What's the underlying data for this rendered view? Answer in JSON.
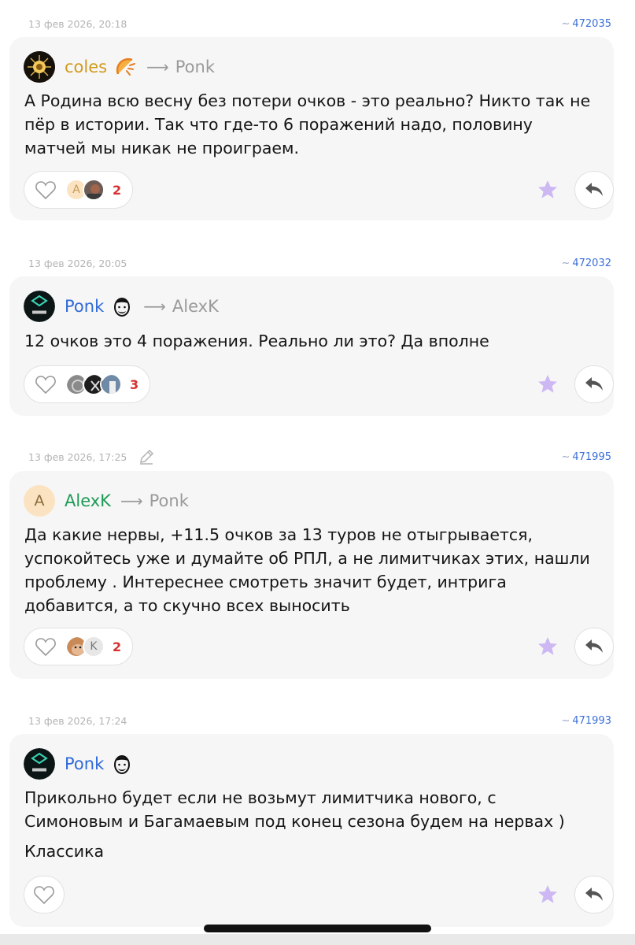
{
  "comments": [
    {
      "date": "13 фев 2026, 20:18",
      "ref_prefix": "~",
      "ref": "472035",
      "author": "coles",
      "arrow": "⟶",
      "reply_to": "Ponk",
      "paragraphs": [
        "А Родина всю весну без потери очков - это реально? Никто так не пёр в истории. Так что где-то 6 поражений надо, половину матчей мы никак не проиграем."
      ],
      "likers": [
        "А"
      ],
      "like_count": "2"
    },
    {
      "date": "13 фев 2026, 20:05",
      "ref_prefix": "~",
      "ref": "472032",
      "author": "Ponk",
      "arrow": "⟶",
      "reply_to": "AlexK",
      "paragraphs": [
        "12 очков это 4 поражения. Реально ли это? Да вполне"
      ],
      "like_count": "3"
    },
    {
      "date": "13 фев 2026, 17:25",
      "ref_prefix": "~",
      "ref": "471995",
      "author": "AlexK",
      "avatar_letter": "A",
      "arrow": "⟶",
      "reply_to": "Ponk",
      "paragraphs": [
        "Да какие нервы, +11.5 очков за 13 туров не отыгрывается, успокойтесь уже и думайте об РПЛ, а не лимитчиках этих, нашли проблему . Интереснее смотреть значит будет, интрига добавится, а то скучно всех выносить"
      ],
      "likers": [
        "K"
      ],
      "like_count": "2"
    },
    {
      "date": "13 фев 2026, 17:24",
      "ref_prefix": "~",
      "ref": "471993",
      "author": "Ponk",
      "paragraphs": [
        "Прикольно будет если не возьмут лимитчика нового, с Симоновым и Багамаевым под конец сезона будем на нервах )",
        "Классика"
      ]
    }
  ],
  "colors": {
    "link_blue": "#2f6ad9",
    "author_gold": "#d19b1a",
    "author_green": "#1f9a57",
    "like_count_red": "#d63031",
    "star_purple": "#cdb8f3",
    "card_bg": "#f6f6f6"
  },
  "icons": [
    "heart-icon",
    "star-icon",
    "reply-icon",
    "edit-pencil-icon",
    "arrow-right"
  ]
}
